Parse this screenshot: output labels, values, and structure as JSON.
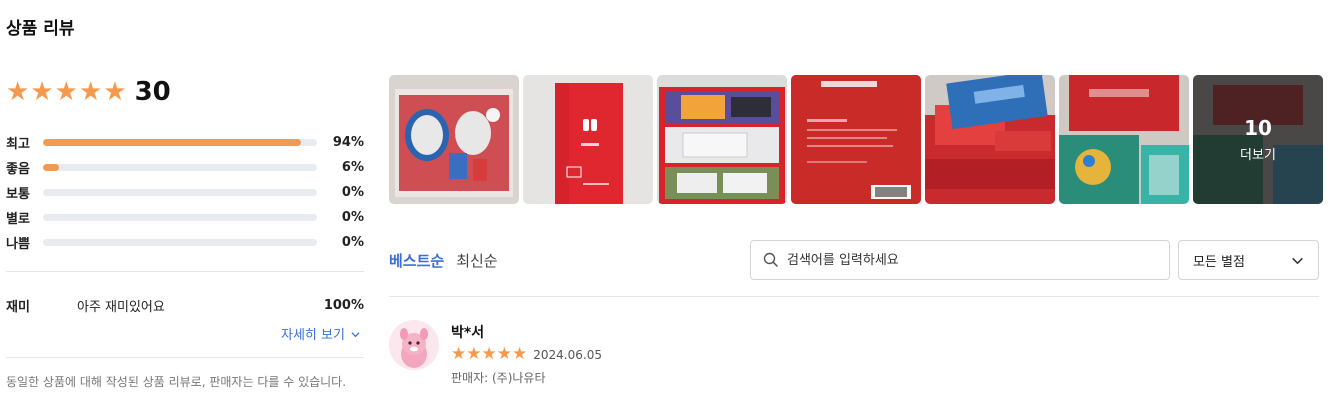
{
  "title": "상품 리뷰",
  "summary": {
    "average_stars": 5,
    "review_count": "30",
    "distribution": [
      {
        "label": "최고",
        "pct_text": "94%",
        "value": 94
      },
      {
        "label": "좋음",
        "pct_text": "6%",
        "value": 6
      },
      {
        "label": "보통",
        "pct_text": "0%",
        "value": 0
      },
      {
        "label": "별로",
        "pct_text": "0%",
        "value": 0
      },
      {
        "label": "나쁨",
        "pct_text": "0%",
        "value": 0
      }
    ],
    "attribute": {
      "name": "재미",
      "value": "아주 재미있어요",
      "pct": "100%"
    },
    "detail_link": "자세히 보기",
    "notice": "동일한 상품에 대해 작성된 상품 리뷰로, 판매자는 다를 수 있습니다."
  },
  "photos": {
    "more_count": "10",
    "more_label": "더보기"
  },
  "sort": {
    "best": "베스트순",
    "newest": "최신순"
  },
  "search": {
    "placeholder": "검색어를 입력하세요"
  },
  "filter": {
    "selected": "모든 별점"
  },
  "review": {
    "name": "박*서",
    "stars": 5,
    "date": "2024.06.05",
    "seller": "판매자: (주)나유타"
  },
  "colors": {
    "accent": "#3b6fd8",
    "star": "#f59a4c",
    "bar_track": "#e8ebef"
  },
  "icons": {
    "star": "star-icon",
    "search": "search-icon",
    "chevron": "chevron-down-icon"
  }
}
